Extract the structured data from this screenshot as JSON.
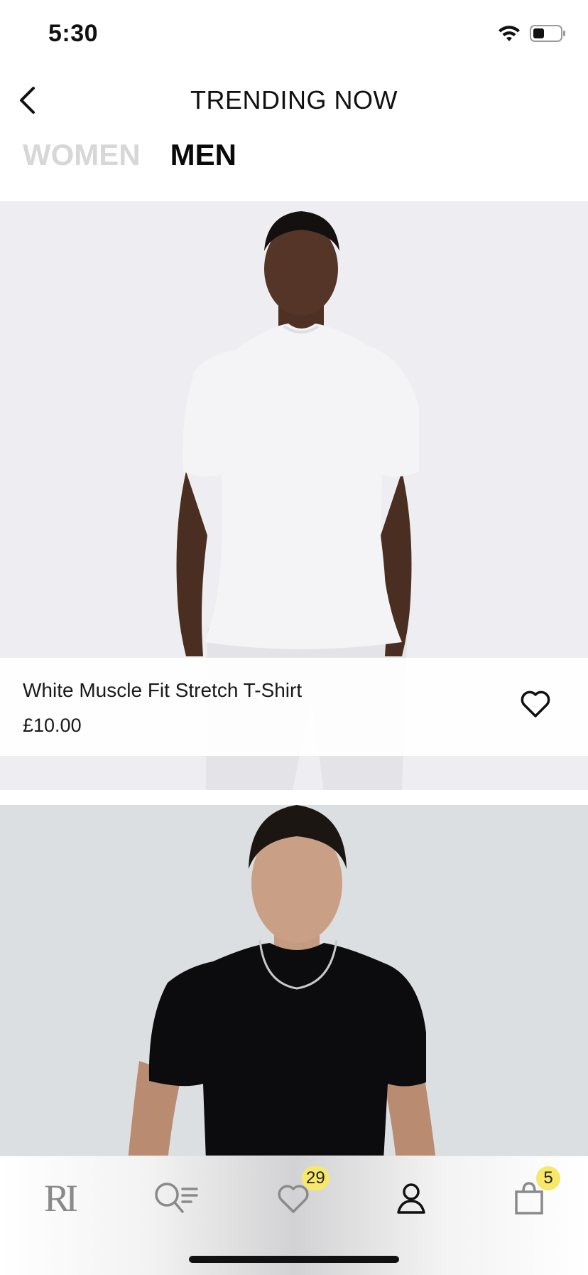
{
  "status_bar": {
    "time": "5:30"
  },
  "header": {
    "title": "TRENDING NOW"
  },
  "tabs": [
    {
      "label": "WOMEN",
      "active": false
    },
    {
      "label": "MEN",
      "active": true
    }
  ],
  "products": [
    {
      "name": "White Muscle Fit Stretch T-Shirt",
      "price": "£10.00",
      "tshirt_color": "#f4f4f6"
    },
    {
      "name": "",
      "price": "",
      "tshirt_color": "#0c0c0e"
    }
  ],
  "tab_bar": {
    "logo": "RI",
    "wishlist_count": "29",
    "bag_count": "5"
  },
  "icons": {
    "back": "chevron-left-icon",
    "wifi": "wifi-icon",
    "battery": "battery-icon",
    "wishlist": "heart-icon",
    "search": "search-filter-icon",
    "account": "user-icon",
    "bag": "shopping-bag-icon"
  },
  "colors": {
    "badge": "#f7e86a",
    "inactive_tab": "#d7d7d7",
    "active_tab": "#0a0a0a"
  }
}
